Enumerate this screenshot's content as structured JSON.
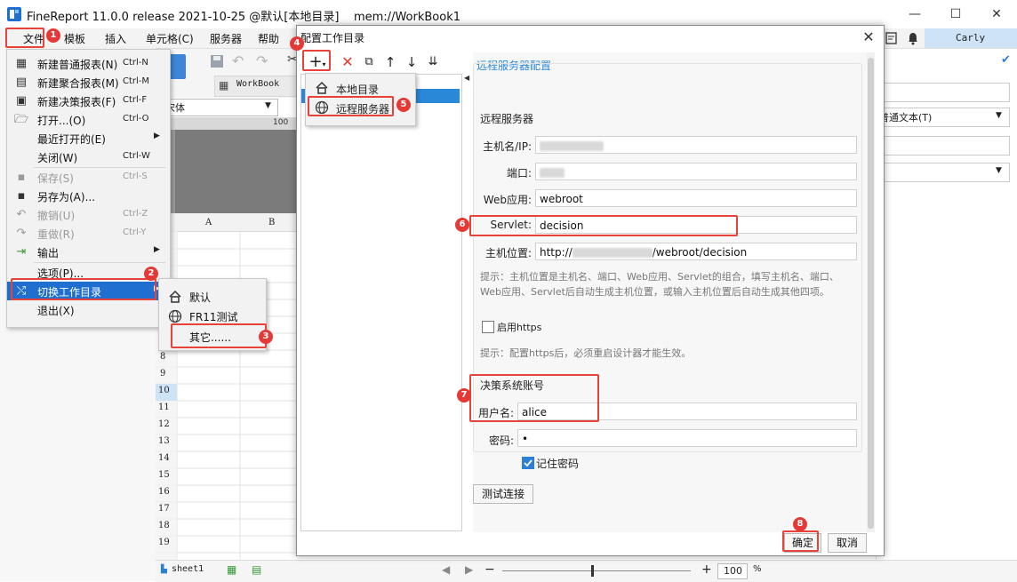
{
  "window": {
    "title": "FineReport 11.0.0 release 2021-10-25 @默认[本地目录]    mem://WorkBook1",
    "user": "Carly"
  },
  "menubar": [
    "文件",
    "模板",
    "插入",
    "单元格(C)",
    "服务器",
    "帮助"
  ],
  "file_menu": [
    {
      "icon": "new-report-icon",
      "label": "新建普通报表(N)",
      "shortcut": "Ctrl-N"
    },
    {
      "icon": "new-aggregate-report-icon",
      "label": "新建聚合报表(M)",
      "shortcut": "Ctrl-M"
    },
    {
      "icon": "new-dashboard-icon",
      "label": "新建决策报表(F)",
      "shortcut": "Ctrl-F"
    },
    {
      "icon": "open-folder-icon",
      "label": "打开...(O)",
      "shortcut": "Ctrl-O"
    },
    {
      "label": "最近打开的(E)",
      "submenu": true
    },
    {
      "label": "关闭(W)",
      "shortcut": "Ctrl-W"
    },
    {
      "icon": "save-icon",
      "label": "保存(S)",
      "shortcut": "Ctrl-S",
      "disabled": true
    },
    {
      "icon": "save-as-icon",
      "label": "另存为(A)..."
    },
    {
      "icon": "undo-icon",
      "label": "撤销(U)",
      "shortcut": "Ctrl-Z",
      "disabled": true
    },
    {
      "icon": "redo-icon",
      "label": "重做(R)",
      "shortcut": "Ctrl-Y",
      "disabled": true
    },
    {
      "icon": "export-icon",
      "label": "输出",
      "submenu": true
    },
    {
      "label": "选项(P)..."
    },
    {
      "icon": "switch-icon",
      "label": "切换工作目录",
      "submenu": true,
      "highlighted": true
    },
    {
      "label": "退出(X)"
    }
  ],
  "workdir_submenu": [
    {
      "icon": "home-icon",
      "label": "默认"
    },
    {
      "icon": "globe-icon",
      "label": "FR11测试"
    },
    {
      "label": "其它......"
    }
  ],
  "background": {
    "workbook_tab": "WorkBook",
    "font_name": "宋体",
    "ruler_mark": "100",
    "columns": [
      "A",
      "B"
    ],
    "rows": [
      "8",
      "9",
      "10",
      "11",
      "12",
      "13",
      "14",
      "15",
      "16",
      "17",
      "18",
      "19"
    ],
    "selected_row": "9",
    "sheet_tab": "sheet1",
    "zoom": "100",
    "zoom_unit": "%",
    "right_select_value": "普通文本(T)"
  },
  "dialog": {
    "title": "配置工作目录",
    "add_menu": [
      {
        "icon": "home-icon",
        "label": "本地目录"
      },
      {
        "icon": "globe-icon",
        "label": "远程服务器"
      }
    ],
    "panel_title": "远程服务器配置",
    "section_server": "远程服务器",
    "labels": {
      "host": "主机名/IP:",
      "port": "端口:",
      "webapp": "Web应用:",
      "servlet": "Servlet:",
      "location": "主机位置:"
    },
    "values": {
      "webapp": "webroot",
      "servlet": "decision",
      "location_prefix": "http://",
      "location_suffix": "/webroot/decision"
    },
    "hint_location": "提示：主机位置是主机名、端口、Web应用、Servlet的组合，填写主机名、端口、Web应用、Servlet后自动生成主机位置，或输入主机位置后自动生成其他四项。",
    "https_label": "启用https",
    "https_checked": false,
    "hint_https": "提示：配置https后，必须重启设计器才能生效。",
    "section_account": "决策系统账号",
    "username_label": "用户名:",
    "username": "alice",
    "password_label": "密码:",
    "password": "•",
    "remember_label": "记住密码",
    "remember_checked": true,
    "test_button": "测试连接",
    "ok_button": "确定",
    "cancel_button": "取消"
  },
  "annotations": [
    "1",
    "2",
    "3",
    "4",
    "5",
    "6",
    "7",
    "8"
  ],
  "colors": {
    "accent": "#1e6fd0",
    "panel_title": "#2a88d8",
    "annotation_red": "#e53935"
  }
}
